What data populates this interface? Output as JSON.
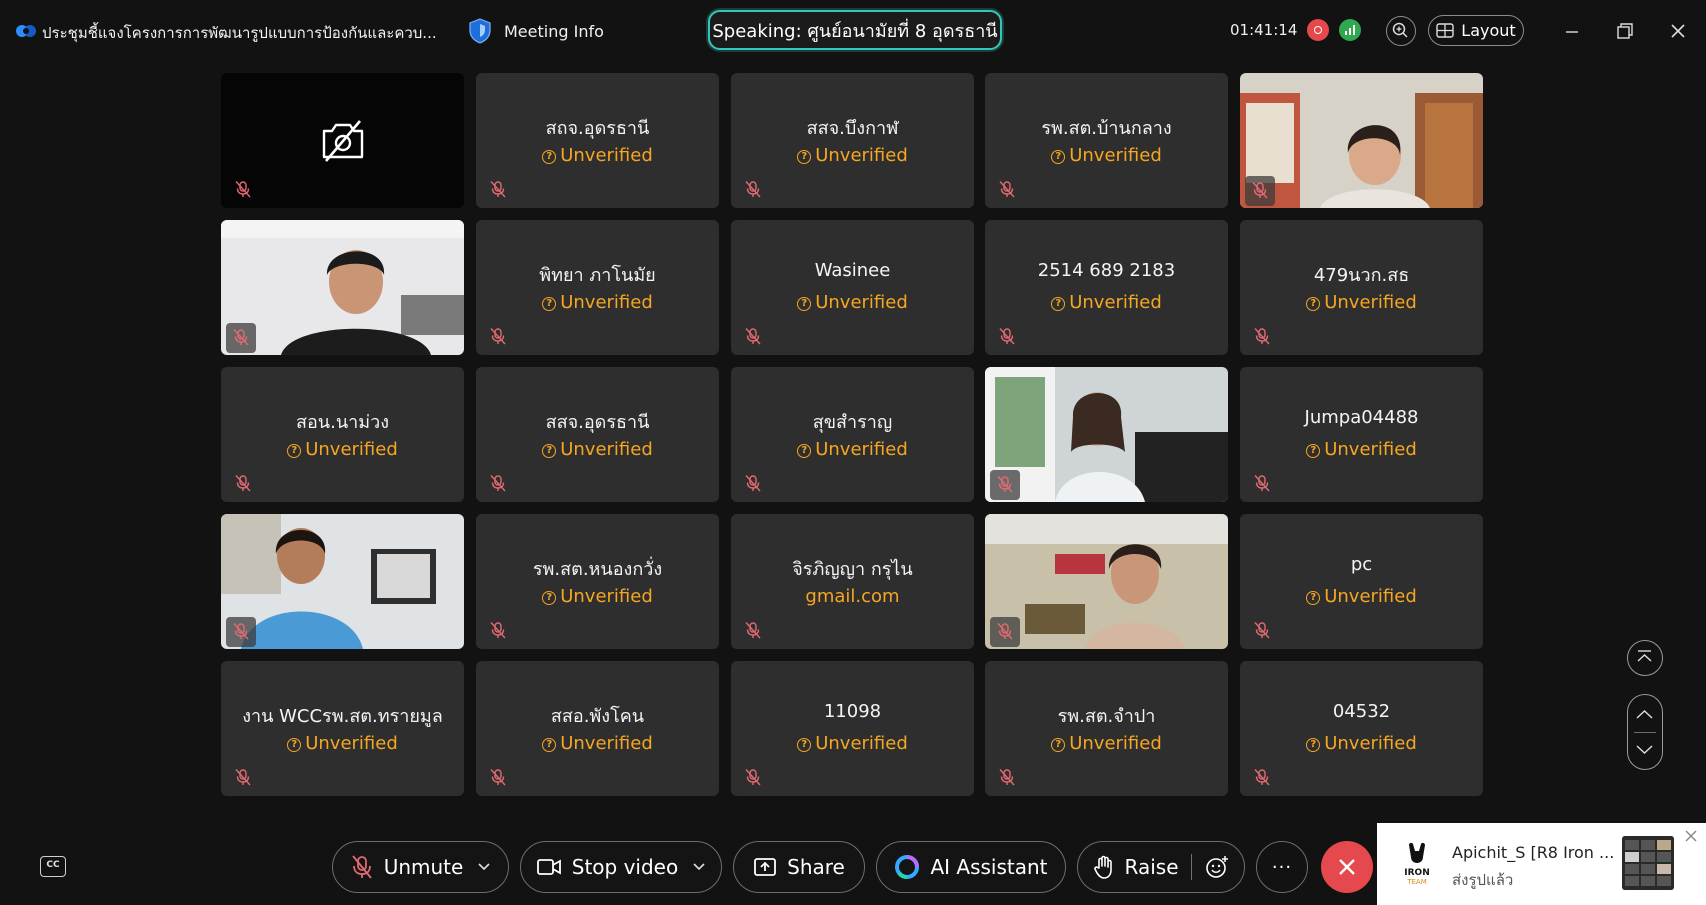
{
  "window": {
    "title": "ประชุมชี้แจงโครงการการพัฒนารูปแบบการป้องกันและควบ...",
    "meeting_info_label": "Meeting Info",
    "speaking": "Speaking: ศูนย์อนามัยที่ 8 อุดรธานี",
    "timer": "01:41:14",
    "layout_label": "Layout"
  },
  "participants": [
    {
      "name": "",
      "status": "",
      "kind": "camera-off"
    },
    {
      "name": "สถจ.อุดรธานี",
      "status": "Unverified",
      "kind": "name"
    },
    {
      "name": "สสจ.บึงกาฬ",
      "status": "Unverified",
      "kind": "name"
    },
    {
      "name": "รพ.สต.บ้านกลาง",
      "status": "Unverified",
      "kind": "name"
    },
    {
      "name": "",
      "status": "",
      "kind": "video"
    },
    {
      "name": "",
      "status": "",
      "kind": "video"
    },
    {
      "name": "พิทยา ภาโนมัย",
      "status": "Unverified",
      "kind": "name"
    },
    {
      "name": "Wasinee",
      "status": "Unverified",
      "kind": "name"
    },
    {
      "name": "2514 689 2183",
      "status": "Unverified",
      "kind": "name"
    },
    {
      "name": "479นวก.สธ",
      "status": "Unverified",
      "kind": "name"
    },
    {
      "name": "สอน.นาม่วง",
      "status": "Unverified",
      "kind": "name"
    },
    {
      "name": "สสจ.อุดรธานี",
      "status": "Unverified",
      "kind": "name"
    },
    {
      "name": "สุขสำราญ",
      "status": "Unverified",
      "kind": "name"
    },
    {
      "name": "",
      "status": "",
      "kind": "video"
    },
    {
      "name": "Jumpa04488",
      "status": "Unverified",
      "kind": "name"
    },
    {
      "name": "",
      "status": "",
      "kind": "video"
    },
    {
      "name": "รพ.สต.หนองกวั่ง",
      "status": "Unverified",
      "kind": "name"
    },
    {
      "name": "จิรภิญญา กรุไน",
      "status": "gmail.com",
      "kind": "name"
    },
    {
      "name": "",
      "status": "",
      "kind": "video"
    },
    {
      "name": "pc",
      "status": "Unverified",
      "kind": "name"
    },
    {
      "name": "งาน WCCรพ.สต.ทรายมูล",
      "status": "Unverified",
      "kind": "name"
    },
    {
      "name": "สสอ.พังโคน",
      "status": "Unverified",
      "kind": "name"
    },
    {
      "name": "11098",
      "status": "Unverified",
      "kind": "name"
    },
    {
      "name": "รพ.สต.จำปา",
      "status": "Unverified",
      "kind": "name"
    },
    {
      "name": "04532",
      "status": "Unverified",
      "kind": "name"
    }
  ],
  "toolbar": {
    "cc_label": "CC",
    "unmute_label": "Unmute",
    "stop_video_label": "Stop video",
    "share_label": "Share",
    "ai_assistant_label": "AI Assistant",
    "raise_label": "Raise",
    "more_label": "···"
  },
  "notification": {
    "title": "Apichit_S [R8 Iron ...",
    "subtitle": "ส่งรูปแล้ว",
    "logo_text": "IRON TEAM"
  },
  "colors": {
    "accent_speaking": "#35c6b8",
    "unverified": "#f5a623",
    "mute_red": "#e36a72",
    "leave_red": "#e5484d",
    "record_red": "#e5484d",
    "network_green": "#2fa84f"
  }
}
